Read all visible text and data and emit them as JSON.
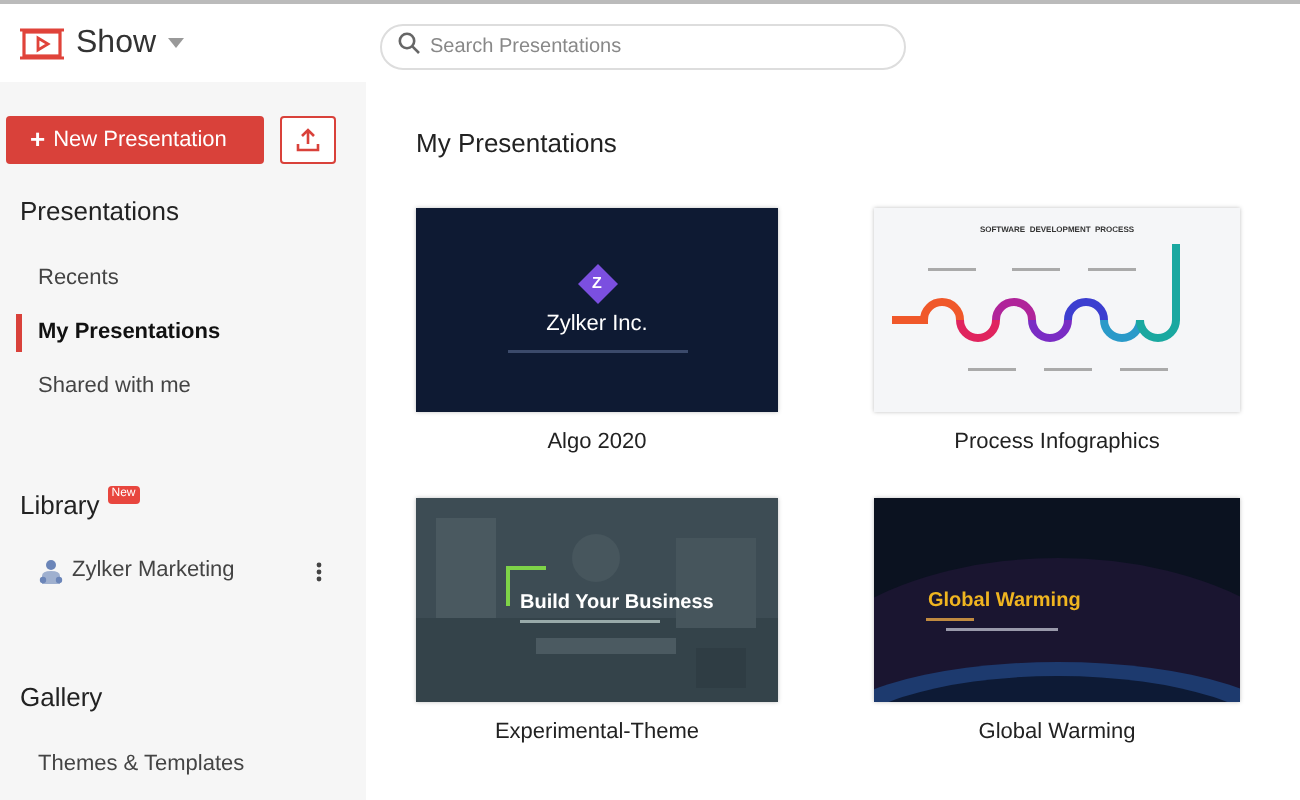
{
  "app": {
    "name": "Show"
  },
  "search": {
    "placeholder": "Search Presentations"
  },
  "sidebar": {
    "new_button": "New Presentation",
    "new_icon": "+",
    "sections": [
      {
        "title": "Presentations",
        "items": [
          {
            "label": "Recents",
            "selected": false
          },
          {
            "label": "My Presentations",
            "selected": true
          },
          {
            "label": "Shared with me",
            "selected": false
          }
        ]
      },
      {
        "title": "Library",
        "badge": "New",
        "items": [
          {
            "label": "Zylker Marketing",
            "selected": false,
            "kind": "team"
          }
        ]
      },
      {
        "title": "Gallery",
        "items": [
          {
            "label": "Themes & Templates",
            "selected": false
          }
        ]
      }
    ]
  },
  "main": {
    "title": "My Presentations",
    "presentations": [
      {
        "name": "Algo 2020",
        "slide": {
          "kind": "logo",
          "title": "Zylker Inc.",
          "logo": "Z"
        }
      },
      {
        "name": "Process Infographics",
        "slide": {
          "kind": "process",
          "title": "SOFTWARE  DEVELOPMENT  PROCESS"
        }
      },
      {
        "name": "Experimental-Theme",
        "slide": {
          "title": "Build Your Business"
        }
      },
      {
        "name": "Global Warming",
        "slide": {
          "kind": "space",
          "title": "Global Warming"
        }
      }
    ]
  }
}
